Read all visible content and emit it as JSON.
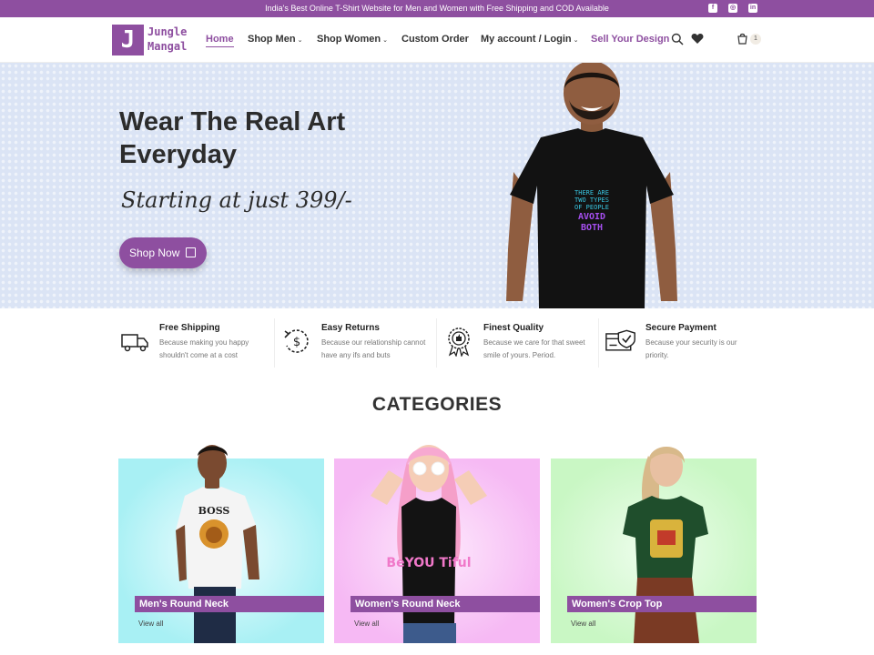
{
  "topbar": {
    "message": "India's Best Online T-Shirt Website for Men and Women with Free Shipping and COD Available",
    "social": [
      "facebook-icon",
      "instagram-icon",
      "linkedin-icon"
    ]
  },
  "header": {
    "logo_letter": "J",
    "logo_line1": "Jungle",
    "logo_line2": "Mangal",
    "nav": {
      "home": "Home",
      "shop_men": "Shop Men",
      "shop_women": "Shop Women",
      "custom_order": "Custom Order",
      "account": "My account / Login",
      "sell": "Sell Your Design"
    },
    "cart_count": "1"
  },
  "hero": {
    "title": "Wear The Real Art Everyday",
    "subtitle": "Starting at just 399/-",
    "button": "Shop Now",
    "tshirt_text": [
      "THERE ARE",
      "TWO TYPES",
      "OF PEOPLE",
      "AVOID",
      "BOTH"
    ]
  },
  "features": [
    {
      "title": "Free Shipping",
      "desc": "Because making you happy shouldn't come at a cost",
      "icon": "truck-icon"
    },
    {
      "title": "Easy Returns",
      "desc": "Because our relationship cannot have any ifs and buts",
      "icon": "return-icon"
    },
    {
      "title": "Finest Quality",
      "desc": "Because we care for that sweet smile of yours. Period.",
      "icon": "quality-badge-icon"
    },
    {
      "title": "Secure Payment",
      "desc": "Because your security is our priority.",
      "icon": "secure-payment-icon"
    }
  ],
  "categories": {
    "heading": "CATEGORIES",
    "items": [
      {
        "label": "Men's Round Neck",
        "view": "View all",
        "bg": "#a8f0f4",
        "shirt_text": "BOSS"
      },
      {
        "label": "Women's Round Neck",
        "view": "View all",
        "bg": "#f6b9f4",
        "shirt_text": "BeYOU Tiful"
      },
      {
        "label": "Women's Crop Top",
        "view": "View all",
        "bg": "#c9f7c4",
        "shirt_text": ""
      }
    ]
  },
  "colors": {
    "brand": "#8e4fa0",
    "hero_bg": "#dbe4f5"
  }
}
